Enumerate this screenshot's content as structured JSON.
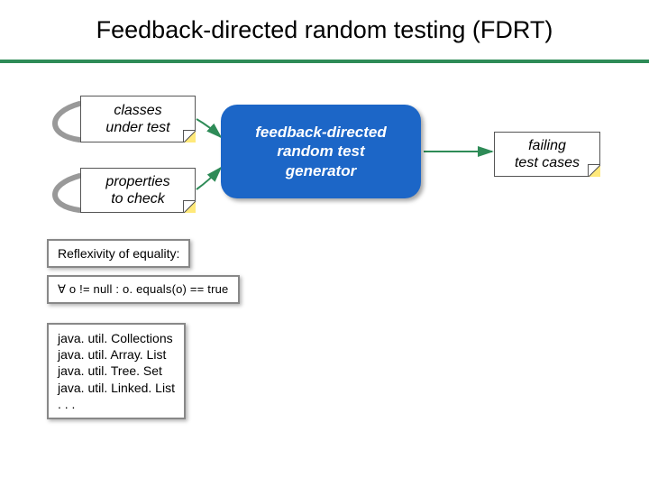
{
  "title": "Feedback-directed random testing (FDRT)",
  "notes": {
    "classes": "classes\nunder test",
    "properties": "properties\nto check",
    "failing": "failing\ntest cases"
  },
  "center": "feedback-directed\nrandom test\ngenerator",
  "callouts": {
    "reflex_heading": "Reflexivity of equality:",
    "equals_rule": "∀ o != null : o. equals(o) == true",
    "class_list": [
      "java. util. Collections",
      "java. util. Array. List",
      "java. util. Tree. Set",
      "java. util. Linked. List",
      ". . ."
    ]
  }
}
